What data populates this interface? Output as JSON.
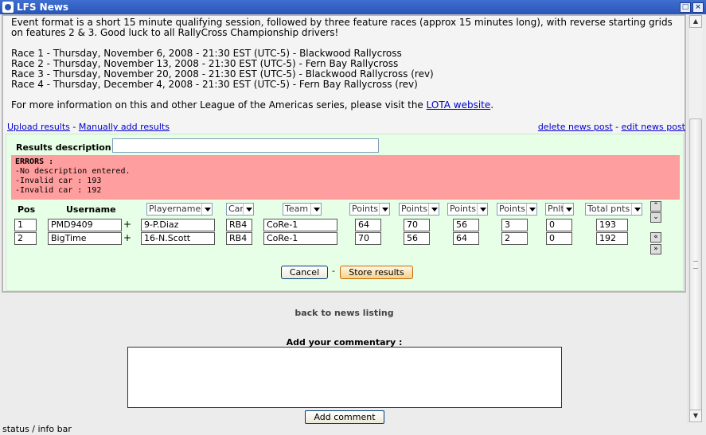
{
  "window": {
    "title": "LFS News"
  },
  "news": {
    "intro": "Event format is a short 15 minute qualifying session, followed by three feature races (approx 15 minutes long), with reverse starting grids on features 2 & 3. Good luck to all RallyCross Championship drivers!",
    "races": [
      "Race 1 - Thursday, November 6, 2008 - 21:30 EST (UTC-5) - Blackwood Rallycross",
      "Race 2 - Thursday, November 13, 2008 - 21:30 EST (UTC-5) - Fern Bay Rallycross",
      "Race 3 - Thursday, November 20, 2008 - 21:30 EST (UTC-5) - Blackwood Rallycross (rev)",
      "Race 4 - Thursday, December 4, 2008 - 21:30 EST (UTC-5) - Fern Bay Rallycross (rev)"
    ],
    "more_info_prefix": "For more information on this and other League of the Americas series, please visit the ",
    "more_info_link": "LOTA website",
    "more_info_suffix": "."
  },
  "links": {
    "upload": "Upload results",
    "separator": " - ",
    "manual": "Manually add results",
    "delete": "delete news post",
    "edit": "edit news post"
  },
  "form": {
    "desc_label": "Results description :",
    "desc_value": "",
    "errors": {
      "title": "ERRORS :",
      "lines": [
        "-No description entered.",
        "-Invalid car : 193",
        "-Invalid car : 192"
      ]
    },
    "headers": {
      "pos": "Pos",
      "username": "Username",
      "playername": "Playername",
      "car": "Car",
      "team": "Team",
      "points1": "Points",
      "points2": "Points",
      "points3": "Points",
      "points4": "Points",
      "pnlt": "Pnlt",
      "total": "Total pnts"
    },
    "rows": [
      {
        "pos": "1",
        "username": "PMD9409",
        "player": "9-P.Diaz",
        "car": "RB4",
        "team": "CoRe-1",
        "p1": "64",
        "p2": "70",
        "p3": "56",
        "p4": "3",
        "pnlt": "0",
        "total": "193"
      },
      {
        "pos": "2",
        "username": "BigTime",
        "player": "16-N.Scott",
        "car": "RB4",
        "team": "CoRe-1",
        "p1": "70",
        "p2": "56",
        "p3": "64",
        "p4": "2",
        "pnlt": "0",
        "total": "192"
      }
    ],
    "cancel": "Cancel",
    "store": "Store results",
    "dash": "-"
  },
  "back": "back to news listing",
  "commentary": {
    "label": "Add your commentary :",
    "value": "",
    "button": "Add comment"
  },
  "status": "status / info bar"
}
